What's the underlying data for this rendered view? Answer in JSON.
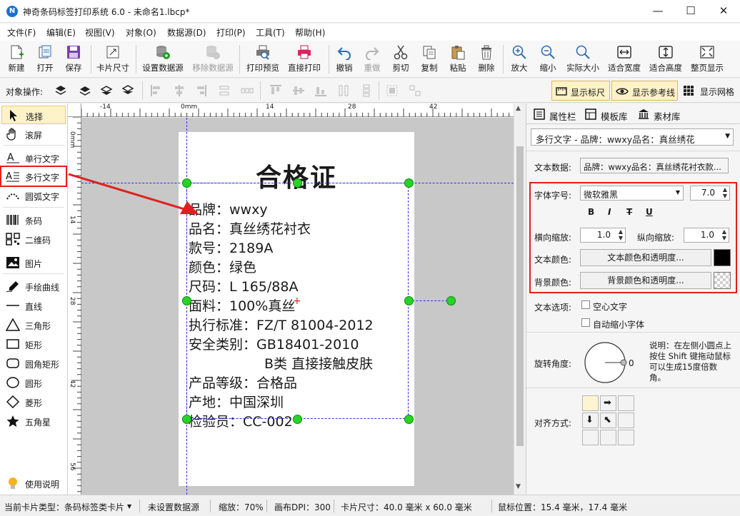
{
  "window": {
    "title": "神奇条码标签打印系统 6.0 - 未命名1.lbcp*",
    "minimize": "—",
    "maximize": "☐",
    "close": "✕"
  },
  "menu": [
    "文件(F)",
    "编辑(E)",
    "视图(V)",
    "对象(O)",
    "数据源(D)",
    "打印(P)",
    "工具(T)",
    "帮助(H)"
  ],
  "toolbar": [
    {
      "label": "新建",
      "icon": "new-file-icon",
      "enabled": true
    },
    {
      "label": "打开",
      "icon": "open-icon",
      "enabled": true
    },
    {
      "label": "保存",
      "icon": "save-icon",
      "enabled": true
    },
    {
      "label": "卡片尺寸",
      "icon": "card-size-icon",
      "enabled": true
    },
    {
      "label": "设置数据源",
      "icon": "set-datasource-icon",
      "enabled": true
    },
    {
      "label": "移除数据源",
      "icon": "remove-datasource-icon",
      "enabled": false
    },
    {
      "label": "打印预览",
      "icon": "print-preview-icon",
      "enabled": true
    },
    {
      "label": "直接打印",
      "icon": "print-icon",
      "enabled": true
    },
    {
      "label": "撤销",
      "icon": "undo-icon",
      "enabled": true
    },
    {
      "label": "重做",
      "icon": "redo-icon",
      "enabled": false
    },
    {
      "label": "剪切",
      "icon": "cut-icon",
      "enabled": true
    },
    {
      "label": "复制",
      "icon": "copy-icon",
      "enabled": true
    },
    {
      "label": "粘贴",
      "icon": "paste-icon",
      "enabled": true
    },
    {
      "label": "删除",
      "icon": "delete-icon",
      "enabled": true
    },
    {
      "label": "放大",
      "icon": "zoom-in-icon",
      "enabled": true
    },
    {
      "label": "缩小",
      "icon": "zoom-out-icon",
      "enabled": true
    },
    {
      "label": "实际大小",
      "icon": "actual-size-icon",
      "enabled": true
    },
    {
      "label": "适合宽度",
      "icon": "fit-width-icon",
      "enabled": true
    },
    {
      "label": "适合高度",
      "icon": "fit-height-icon",
      "enabled": true
    },
    {
      "label": "整页显示",
      "icon": "fit-page-icon",
      "enabled": true
    }
  ],
  "objbar": {
    "label": "对象操作:",
    "show_ruler": "显示标尺",
    "show_guides": "显示参考线",
    "show_grid": "显示网格"
  },
  "tools": [
    {
      "label": "选择",
      "icon": "select-arrow-icon",
      "active": true
    },
    {
      "label": "滚屏",
      "icon": "hand-icon"
    },
    {
      "label": "单行文字",
      "icon": "single-line-text-icon"
    },
    {
      "label": "多行文字",
      "icon": "multi-line-text-icon",
      "highlighted": true
    },
    {
      "label": "圆弧文字",
      "icon": "arc-text-icon"
    },
    {
      "label": "条码",
      "icon": "barcode-icon"
    },
    {
      "label": "二维码",
      "icon": "qrcode-icon"
    },
    {
      "label": "图片",
      "icon": "image-icon"
    },
    {
      "label": "手绘曲线",
      "icon": "freehand-icon"
    },
    {
      "label": "直线",
      "icon": "line-icon"
    },
    {
      "label": "三角形",
      "icon": "triangle-icon"
    },
    {
      "label": "矩形",
      "icon": "rectangle-icon"
    },
    {
      "label": "圆角矩形",
      "icon": "rounded-rectangle-icon"
    },
    {
      "label": "圆形",
      "icon": "circle-icon"
    },
    {
      "label": "菱形",
      "icon": "diamond-icon"
    },
    {
      "label": "五角星",
      "icon": "star-icon"
    }
  ],
  "help_label": "使用说明",
  "ruler": {
    "h": [
      "-14",
      "0mm",
      "14",
      "28",
      "42"
    ],
    "v": [
      "0mm",
      "14",
      "28",
      "42",
      "56"
    ]
  },
  "label": {
    "title": "合格证",
    "lines": [
      "品牌：wwxy",
      "品名：真丝绣花衬衣",
      "款号：2189A",
      "颜色：绿色",
      "尺码：L 165/88A",
      "面料：100%真丝",
      "执行标准：FZ/T 81004-2012",
      "安全类别：GB18401-2010",
      "B类 直接接触皮肤",
      "产品等级：合格品",
      "产地：中国深圳",
      "检验员：CC-002"
    ]
  },
  "panel": {
    "tabs": [
      "属性栏",
      "模板库",
      "素材库"
    ],
    "object_select": "多行文字 - 品牌：wwxy品名：真丝绣花",
    "text_data_label": "文本数据:",
    "text_data_value": "品牌：wwxy品名：真丝绣花衬衣款...",
    "font_label": "字体字号:",
    "font_value": "微软雅黑",
    "font_size": "7.0",
    "style_bold": "B",
    "style_italic": "I",
    "style_strike": "T",
    "style_underline": "U",
    "hscale_label": "横向缩放:",
    "hscale_value": "1.0",
    "vscale_label": "纵向缩放:",
    "vscale_value": "1.0",
    "text_color_label": "文本颜色:",
    "text_color_button": "文本颜色和透明度...",
    "text_color": "#000000",
    "bg_color_label": "背景颜色:",
    "bg_color_button": "背景颜色和透明度...",
    "text_options_label": "文本选项:",
    "hollow_text": "空心文字",
    "auto_shrink": "自动缩小字体",
    "rotation_label": "旋转角度:",
    "rotation_value": "0",
    "rotation_hint": "说明：在左侧小圆点上按住 Shift 键拖动鼠标可以生成15度倍数角。",
    "align_label": "对齐方式:"
  },
  "status": {
    "card_type": "当前卡片类型：条码标签类卡片",
    "datasource": "未设置数据源",
    "zoom": "缩放：70%",
    "dpi": "画布DPI：300",
    "card_size": "卡片尺寸：40.0 毫米 x 60.0 毫米",
    "mouse_pos": "鼠标位置：15.4 毫米，17.4 毫米"
  },
  "colors": {
    "accent": "#1a6fd6",
    "handle": "#27d327",
    "highlight": "#e02020",
    "guide": "#3030e0"
  }
}
